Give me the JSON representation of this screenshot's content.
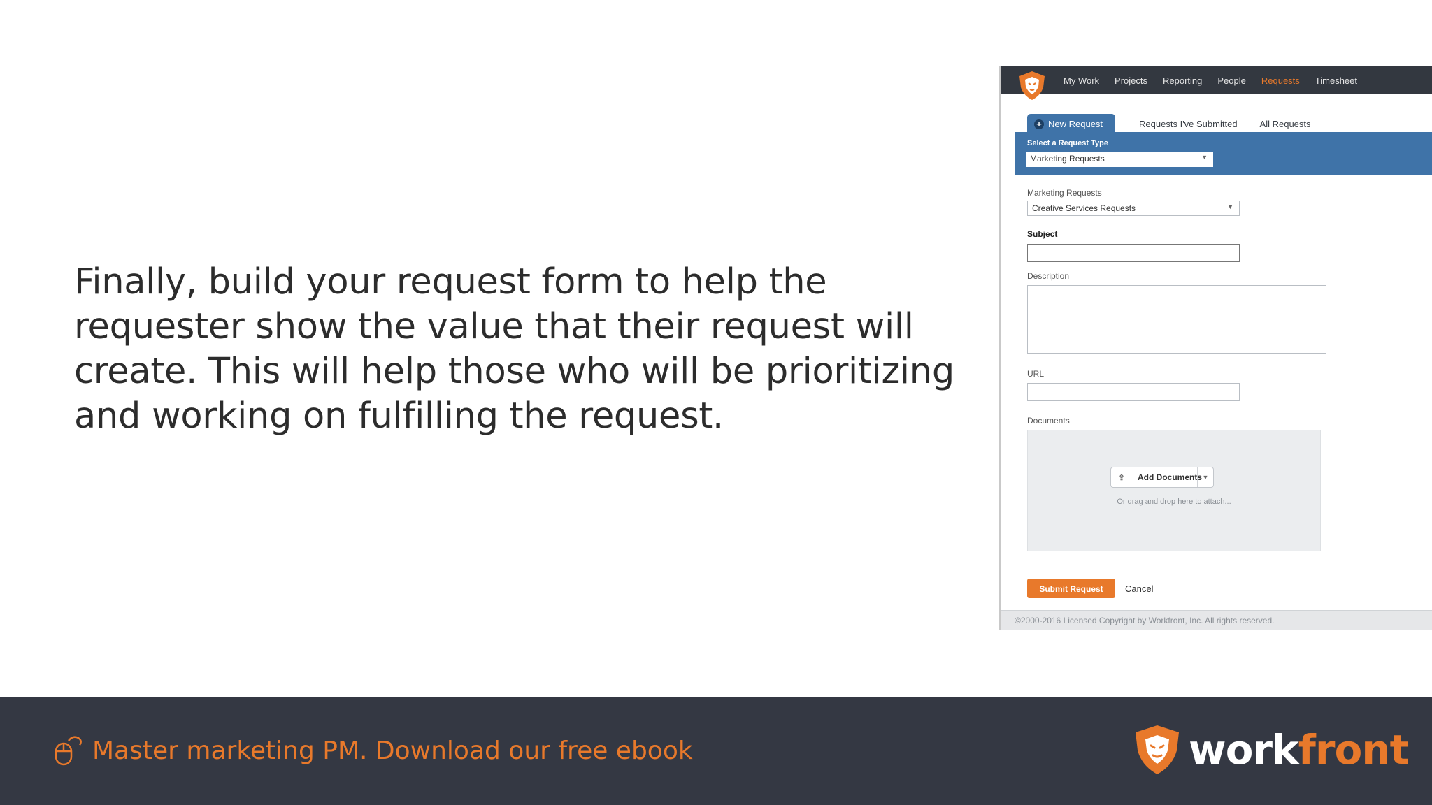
{
  "slide": {
    "body_text": "Finally, build your request form to help the requester show the value that their request will create. This will help those who will be prioritizing and working on fulfilling the request."
  },
  "app": {
    "nav": [
      "My Work",
      "Projects",
      "Reporting",
      "People",
      "Requests",
      "Timesheet"
    ],
    "active_nav": "Requests",
    "tabs": {
      "new_request": "New Request",
      "submitted": "Requests I've Submitted",
      "all": "All Requests"
    },
    "request_type": {
      "label": "Select a Request Type",
      "value": "Marketing Requests"
    },
    "queue_topic": {
      "label": "Marketing Requests",
      "value": "Creative Services Requests"
    },
    "fields": {
      "subject_label": "Subject",
      "subject_value": "",
      "description_label": "Description",
      "url_label": "URL",
      "documents_label": "Documents",
      "add_documents": "Add Documents",
      "drop_hint": "Or drag and drop here to attach..."
    },
    "actions": {
      "submit": "Submit Request",
      "cancel": "Cancel"
    },
    "copyright": "©2000-2016 Licensed Copyright by Workfront, Inc. All rights reserved."
  },
  "footer": {
    "cta": "Master marketing PM. Download our free ebook",
    "brand_name_part1": "work",
    "brand_name_part2": "front"
  },
  "colors": {
    "accent": "#e8792b",
    "nav_bg": "#333840",
    "band_blue": "#3f73a8",
    "footer_bg": "#343843"
  },
  "icons": [
    "workfront-logo-icon",
    "plus-circle-icon",
    "upload-icon",
    "chevron-down-icon",
    "mouse-click-icon"
  ]
}
